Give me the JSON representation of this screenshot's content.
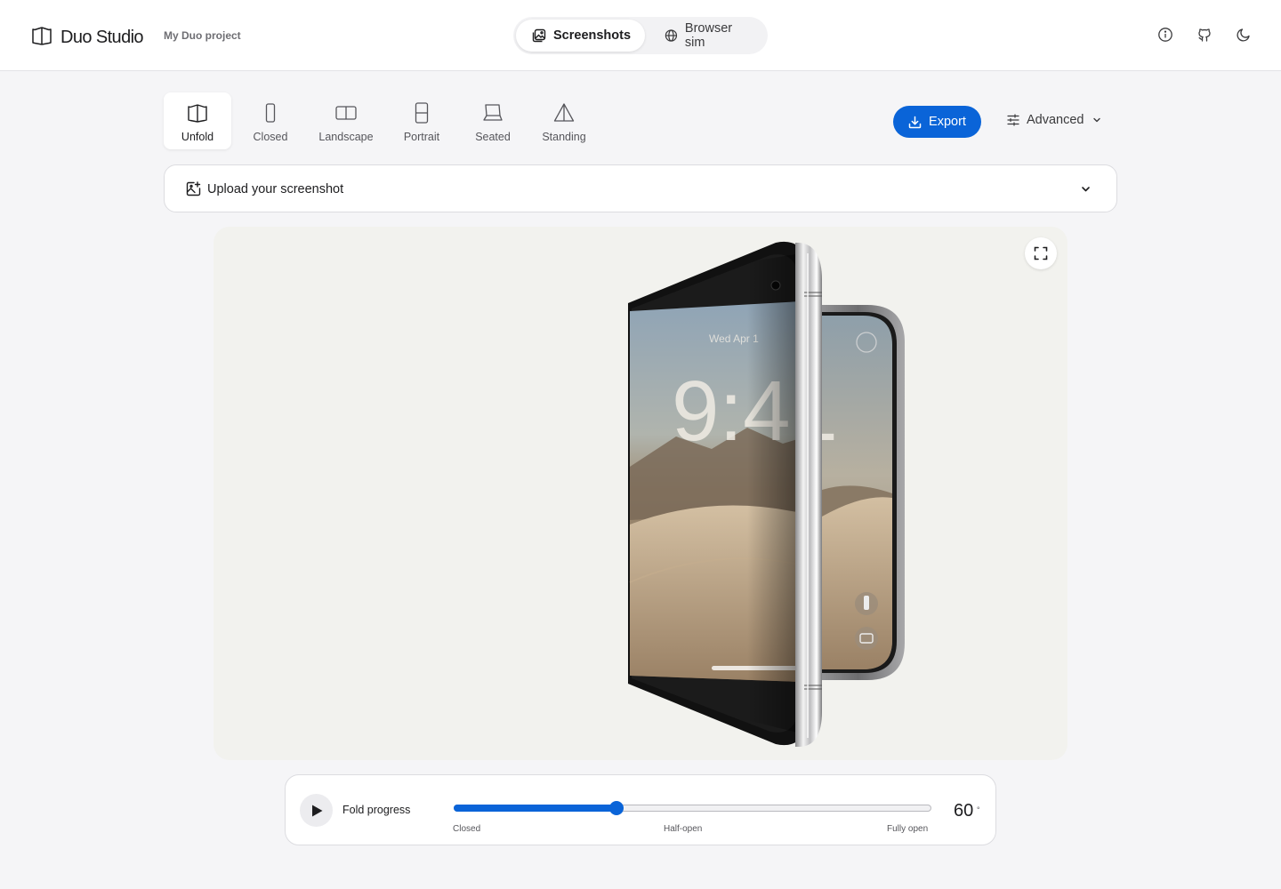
{
  "header": {
    "app_name": "Duo Studio",
    "project_name": "My Duo project",
    "tabs": [
      {
        "label": "Screenshots",
        "icon": "image-gallery-icon",
        "active": true
      },
      {
        "label": "Browser sim",
        "icon": "globe-icon",
        "active": false
      }
    ],
    "actions": [
      "info-icon",
      "github-icon",
      "moon-icon"
    ]
  },
  "modes": [
    {
      "label": "Unfold",
      "icon": "book-open-icon",
      "active": true
    },
    {
      "label": "Closed",
      "icon": "phone-icon",
      "active": false
    },
    {
      "label": "Landscape",
      "icon": "landscape-split-icon",
      "active": false
    },
    {
      "label": "Portrait",
      "icon": "portrait-split-icon",
      "active": false
    },
    {
      "label": "Seated",
      "icon": "laptop-icon",
      "active": false
    },
    {
      "label": "Standing",
      "icon": "tent-icon",
      "active": false
    }
  ],
  "toolbar": {
    "export_label": "Export",
    "advanced_label": "Advanced"
  },
  "upload": {
    "label": "Upload your screenshot"
  },
  "device_screen": {
    "date": "Wed Apr 1",
    "time": "9:41"
  },
  "fold": {
    "title": "Fold progress",
    "progress_fraction": 0.34,
    "value": "60",
    "unit": "°",
    "tick_labels": [
      "Closed",
      "Half-open",
      "Fully open"
    ]
  },
  "colors": {
    "accent": "#0a64d8",
    "page_bg": "#f5f5f7",
    "stage_bg": "#f2f2ee"
  }
}
